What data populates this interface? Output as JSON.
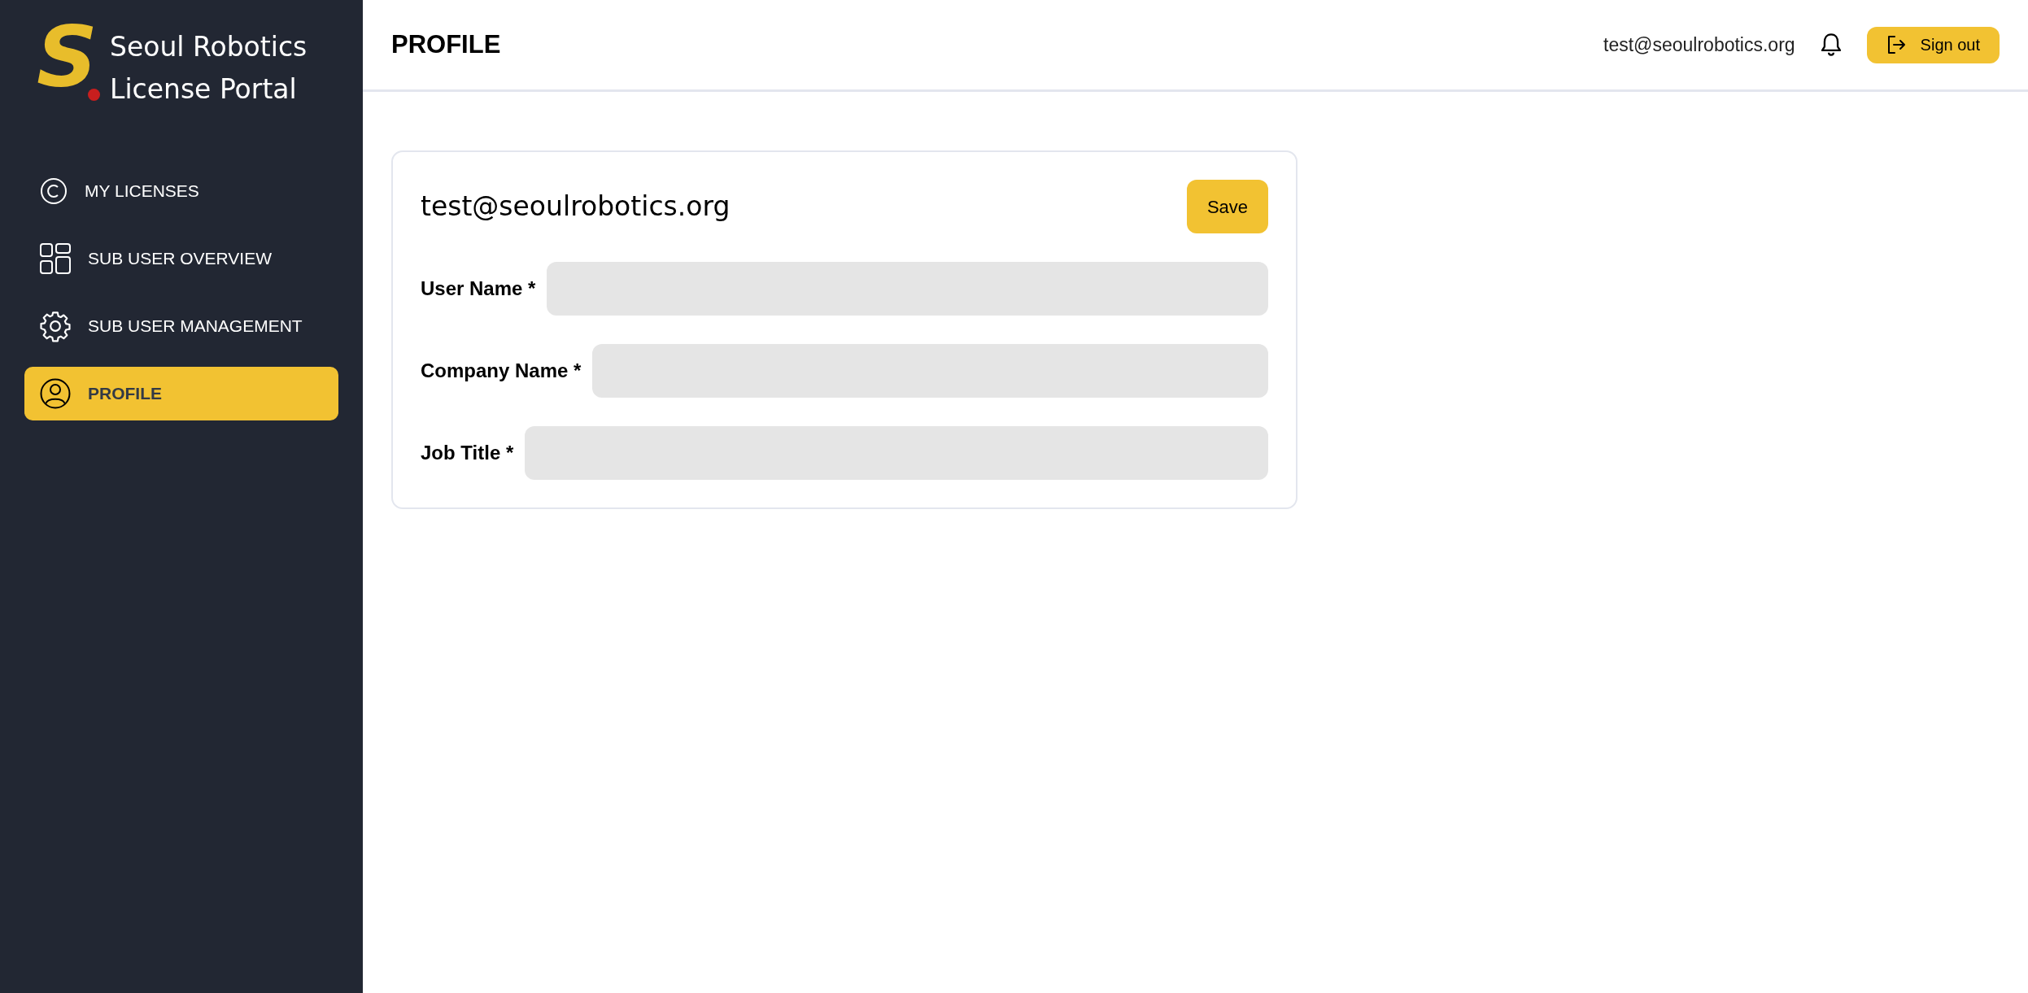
{
  "sidebar": {
    "logo": {
      "mark": "S",
      "title_line1": "Seoul Robotics",
      "title_line2": "License Portal"
    },
    "items": [
      {
        "label": "MY LICENSES",
        "selected": false
      },
      {
        "label": "SUB USER OVERVIEW",
        "selected": false
      },
      {
        "label": "SUB USER MANAGEMENT",
        "selected": false
      },
      {
        "label": "PROFILE",
        "selected": true
      }
    ]
  },
  "header": {
    "title": "PROFILE",
    "email": "test@seoulrobotics.org",
    "sign_out": "Sign out"
  },
  "card": {
    "email": "test@seoulrobotics.org",
    "save": "Save",
    "fields": [
      {
        "label": "User Name *"
      },
      {
        "label": "Company Name *"
      },
      {
        "label": "Job Title *"
      }
    ]
  }
}
